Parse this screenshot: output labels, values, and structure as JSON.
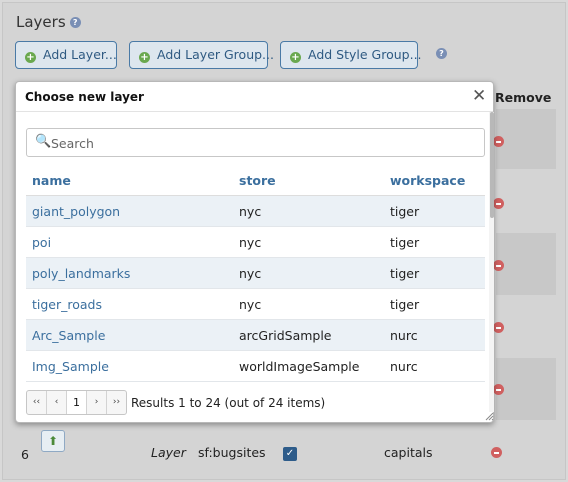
{
  "page": {
    "title": "Layers",
    "buttons": {
      "add_layer": "Add Layer...",
      "add_layer_group": "Add Layer Group...",
      "add_style_group": "Add Style Group..."
    },
    "remove_header": "Remove"
  },
  "background_row": {
    "index": "6",
    "type": "Layer",
    "name": "sf:bugsites",
    "style": "capitals",
    "checked": true
  },
  "dialog": {
    "title": "Choose new layer",
    "search_placeholder": "Search",
    "columns": [
      "name",
      "store",
      "workspace"
    ],
    "rows": [
      {
        "name": "giant_polygon",
        "store": "nyc",
        "workspace": "tiger"
      },
      {
        "name": "poi",
        "store": "nyc",
        "workspace": "tiger"
      },
      {
        "name": "poly_landmarks",
        "store": "nyc",
        "workspace": "tiger"
      },
      {
        "name": "tiger_roads",
        "store": "nyc",
        "workspace": "tiger"
      },
      {
        "name": "Arc_Sample",
        "store": "arcGridSample",
        "workspace": "nurc"
      },
      {
        "name": "Img_Sample",
        "store": "worldImageSample",
        "workspace": "nurc"
      }
    ],
    "pager": {
      "first": "‹‹",
      "prev": "‹",
      "current": "1",
      "next": "›",
      "last": "››",
      "results": "Results 1 to 24 (out of 24 items)"
    }
  },
  "colors": {
    "accent": "#3b6f9e",
    "button_border": "#4a7aa6",
    "add_icon": "#6aa84f",
    "remove_icon": "#d06060",
    "row_stripe": "#ebf1f6"
  },
  "icons": [
    "help-icon",
    "add-icon",
    "close-icon",
    "search-icon",
    "remove-icon",
    "move-up-icon",
    "resize-grip-icon"
  ]
}
